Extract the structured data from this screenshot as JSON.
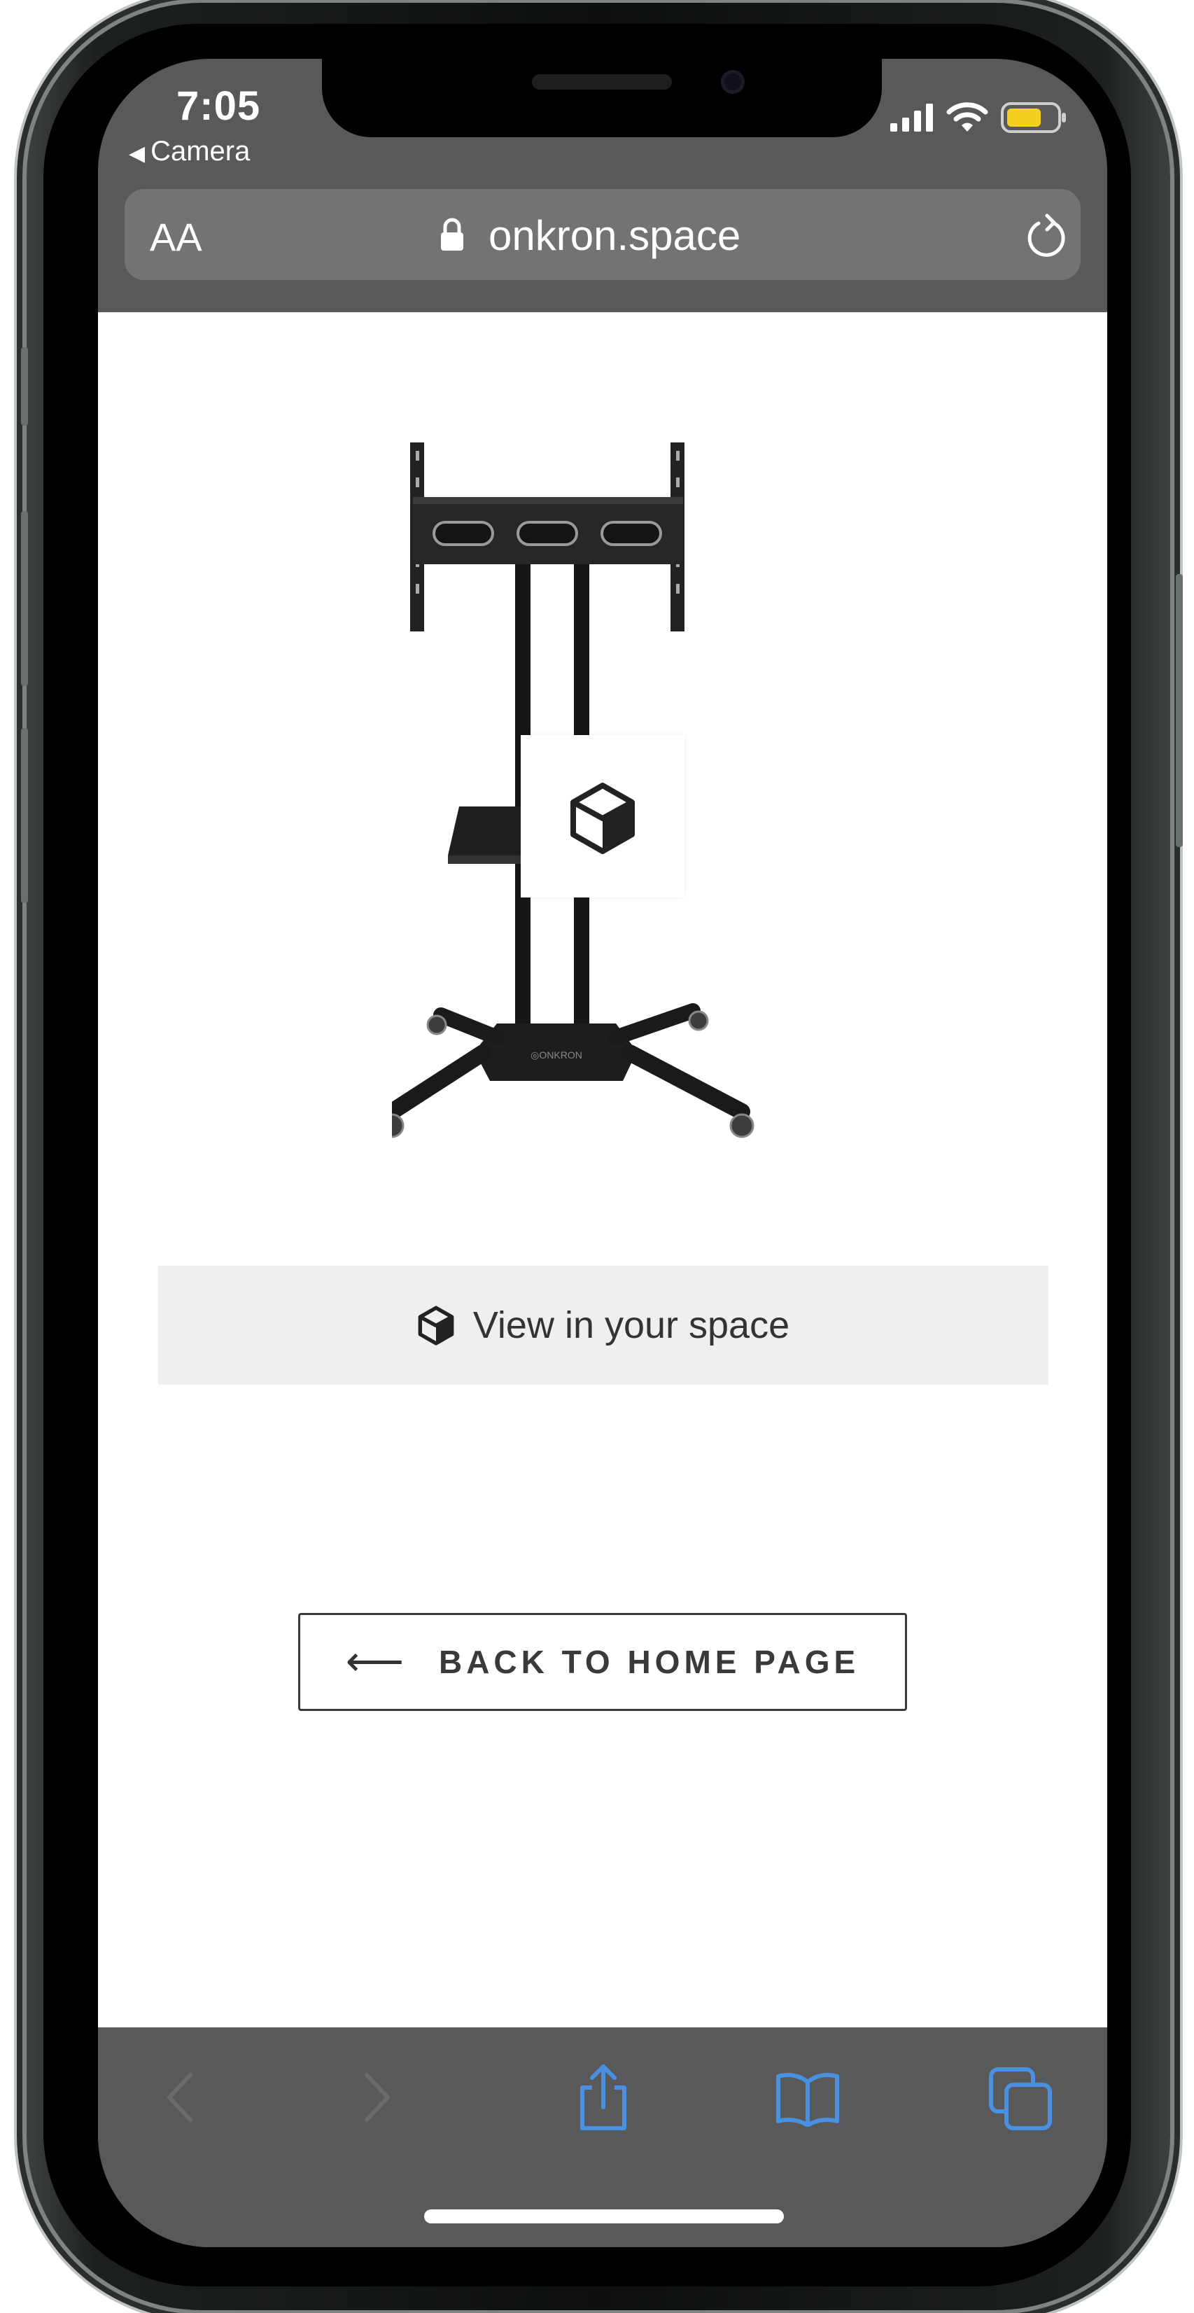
{
  "status_bar": {
    "time": "7:05",
    "back_app": "Camera",
    "icons": [
      "cellular-signal-icon",
      "wifi-icon",
      "battery-icon"
    ],
    "battery_color": "#f4d120"
  },
  "url_bar": {
    "text_size_label": "AA",
    "domain": "onkron.space",
    "icons": [
      "lock-icon",
      "reload-icon"
    ]
  },
  "content": {
    "product_image": "tv-stand-cart",
    "ar_badge_icon": "ar-cube-icon",
    "view_button_label": "View in your space",
    "home_button_arrow": "⟵",
    "home_button_label": "BACK TO HOME PAGE"
  },
  "toolbar": {
    "items": [
      "back-icon",
      "forward-icon",
      "share-icon",
      "bookmarks-icon",
      "tabs-icon"
    ],
    "accent_color": "#4a90e2",
    "disabled_color": "#6b6b6b"
  },
  "colors": {
    "browser_chrome": "#595959",
    "url_bar": "#737373",
    "view_button_bg": "#efefef"
  }
}
